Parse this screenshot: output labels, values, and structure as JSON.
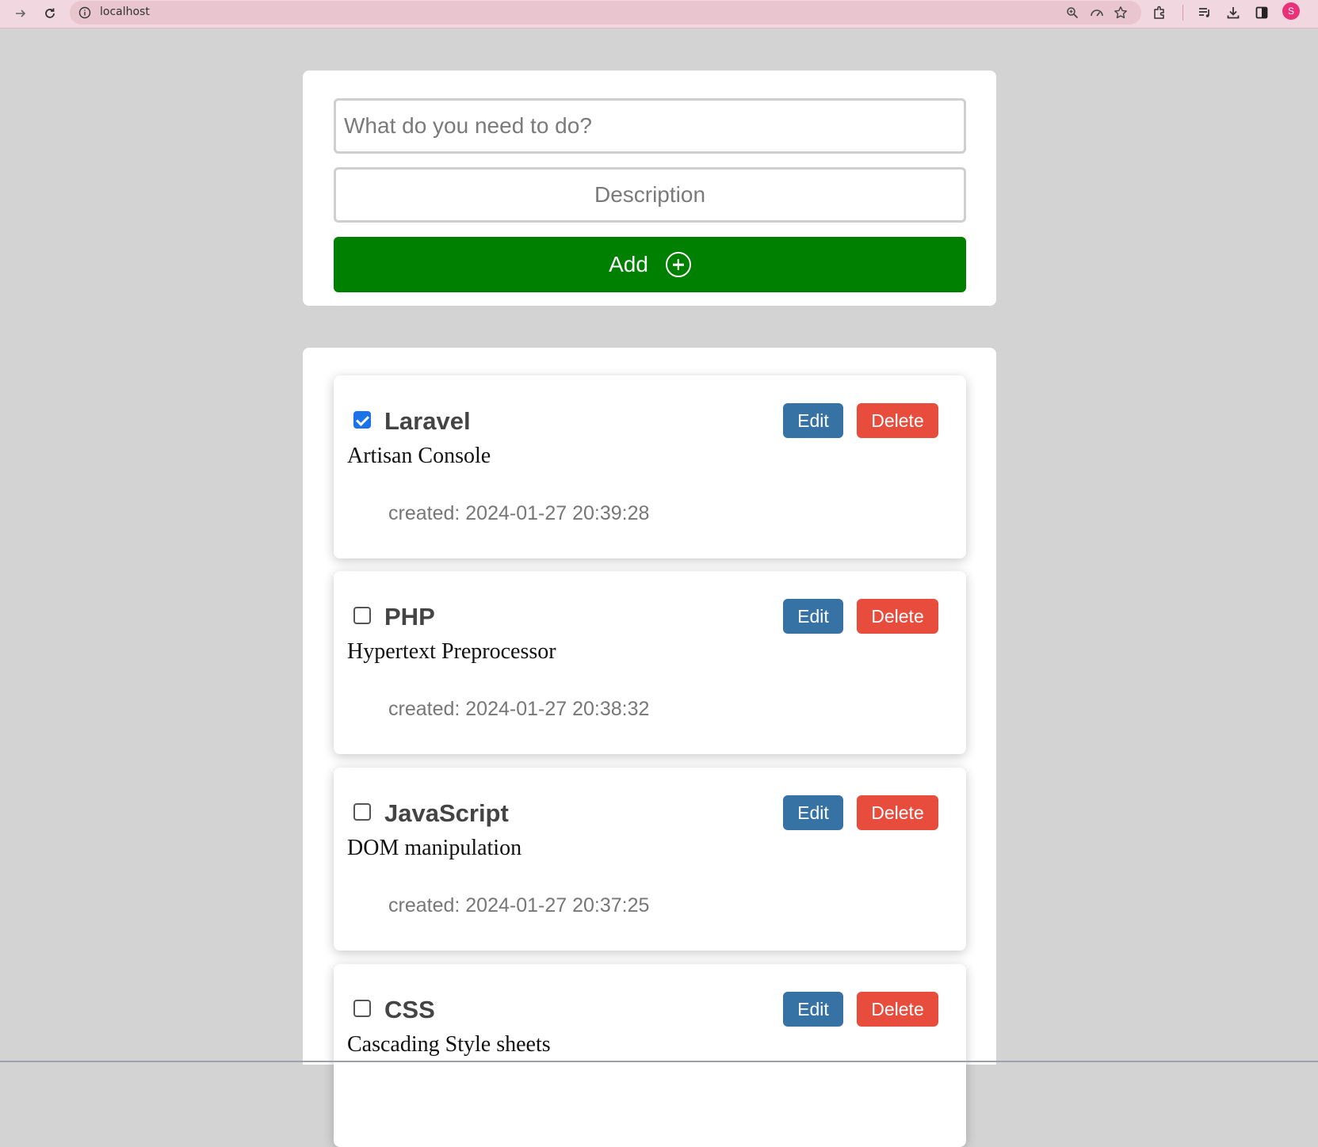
{
  "browser": {
    "url": "localhost",
    "avatar_initial": "S",
    "accent": "#e8327a"
  },
  "form": {
    "task_placeholder": "What do you need to do?",
    "description_placeholder": "Description",
    "add_label": "Add",
    "add_color": "#008000"
  },
  "todos": [
    {
      "title": "Laravel",
      "description": "Artisan Console",
      "created": "created: 2024-01-27 20:39:28",
      "completed": true,
      "edit_label": "Edit",
      "delete_label": "Delete"
    },
    {
      "title": "PHP",
      "description": "Hypertext Preprocessor",
      "created": "created: 2024-01-27 20:38:32",
      "completed": false,
      "edit_label": "Edit",
      "delete_label": "Delete"
    },
    {
      "title": "JavaScript",
      "description": "DOM manipulation",
      "created": "created: 2024-01-27 20:37:25",
      "completed": false,
      "edit_label": "Edit",
      "delete_label": "Delete"
    },
    {
      "title": "CSS",
      "description": "Cascading Style sheets",
      "created": "",
      "completed": false,
      "edit_label": "Edit",
      "delete_label": "Delete"
    }
  ],
  "colors": {
    "edit": "#3672a4",
    "delete": "#e74c3c",
    "background": "#d3d3d3"
  }
}
